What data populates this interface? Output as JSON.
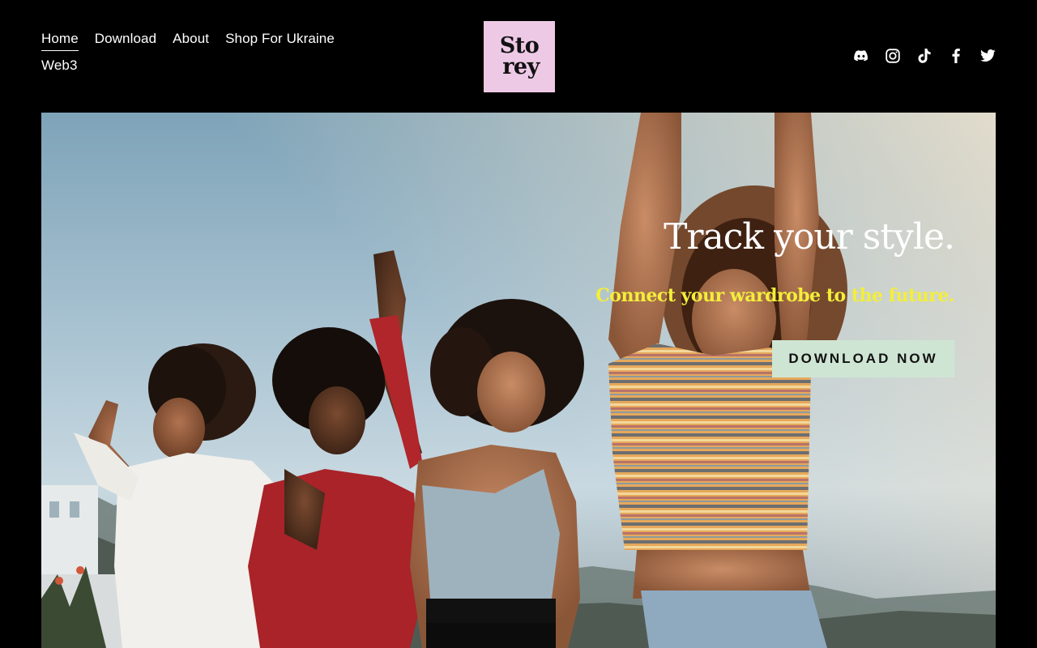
{
  "nav": {
    "items": [
      {
        "label": "Home",
        "active": true
      },
      {
        "label": "Download"
      },
      {
        "label": "About"
      },
      {
        "label": "Shop For Ukraine"
      },
      {
        "label": "Web3"
      }
    ]
  },
  "logo": {
    "line1": "Sto",
    "line2": "rey",
    "bg_color": "#eec9e6"
  },
  "social": {
    "icons": [
      "discord-icon",
      "instagram-icon",
      "tiktok-icon",
      "facebook-icon",
      "twitter-icon"
    ]
  },
  "hero": {
    "title": "Track your style.",
    "subtitle": "Connect your wardrobe to the future.",
    "cta_label": "DOWNLOAD NOW",
    "title_color": "#ffffff",
    "subtitle_color": "#f3ee3a",
    "cta_bg": "#cfe5d4"
  },
  "colors": {
    "background": "#000000",
    "nav_text": "#ffffff"
  }
}
